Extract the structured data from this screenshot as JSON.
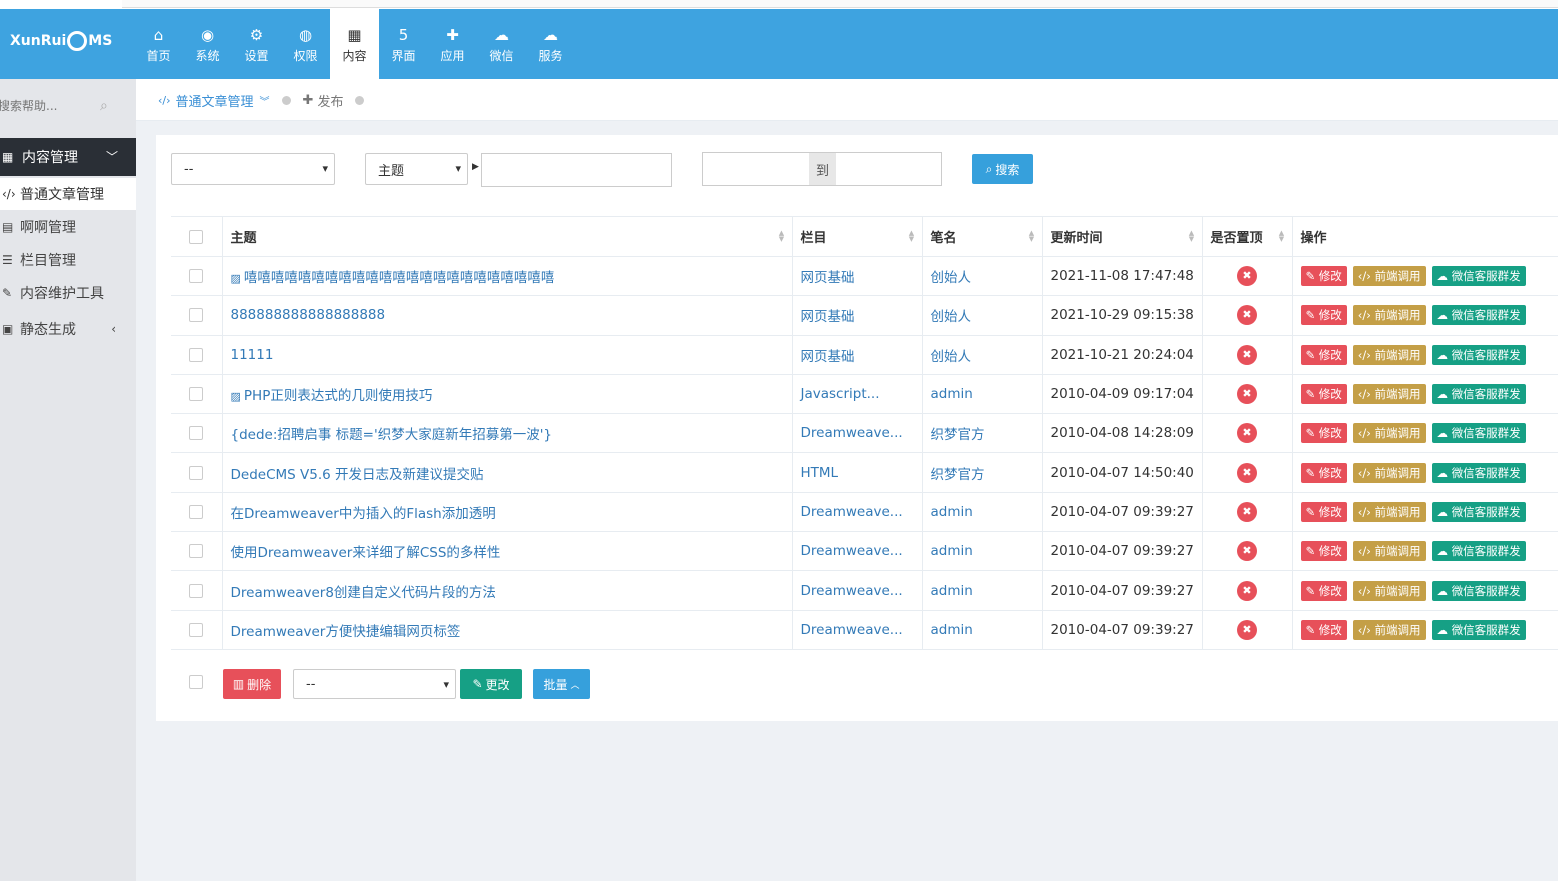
{
  "app": {
    "logo": "XunRui CMS",
    "logo_left": "XunRui",
    "logo_right": "MS"
  },
  "nav": [
    {
      "icon": "home-icon",
      "glyph": "⌂",
      "label": "首页"
    },
    {
      "icon": "globe-icon",
      "glyph": "◉",
      "label": "系统"
    },
    {
      "icon": "gear-icon",
      "glyph": "⚙",
      "label": "设置"
    },
    {
      "icon": "user-icon",
      "glyph": "◍",
      "label": "权限"
    },
    {
      "icon": "grid-icon",
      "glyph": "▦",
      "label": "内容",
      "active": true
    },
    {
      "icon": "html5-icon",
      "glyph": "5",
      "label": "界面"
    },
    {
      "icon": "puzzle-icon",
      "glyph": "✚",
      "label": "应用"
    },
    {
      "icon": "wechat-icon",
      "glyph": "☁",
      "label": "微信"
    },
    {
      "icon": "cloud-icon",
      "glyph": "☁",
      "label": "服务"
    }
  ],
  "sidebar": {
    "search_placeholder": "搜索帮助...",
    "section": "内容管理",
    "items": [
      {
        "label": "普通文章管理",
        "active": true
      },
      {
        "label": "啊啊管理"
      },
      {
        "label": "栏目管理"
      },
      {
        "label": "内容维护工具"
      },
      {
        "label": "静态生成"
      }
    ]
  },
  "breadcrumb": {
    "current": "普通文章管理",
    "publish": "发布"
  },
  "filter": {
    "category_value": "--",
    "field_value": "主题",
    "keyword_value": "",
    "to_label": "到",
    "search_label": "搜索"
  },
  "table": {
    "headers": [
      "主题",
      "栏目",
      "笔名",
      "更新时间",
      "是否置顶",
      "操作"
    ],
    "actions": {
      "edit": "修改",
      "call": "前端调用",
      "wechat": "微信客服群发"
    },
    "rows": [
      {
        "title": "嘻嘻嘻嘻嘻嘻嘻嘻嘻嘻嘻嘻嘻嘻嘻嘻嘻嘻嘻嘻嘻嘻嘻",
        "has_image": true,
        "category": "网页基础",
        "author": "创始人",
        "time": "2021-11-08 17:47:48"
      },
      {
        "title": "888888888888888888",
        "has_image": false,
        "category": "网页基础",
        "author": "创始人",
        "time": "2021-10-29 09:15:38"
      },
      {
        "title": "11111",
        "has_image": false,
        "category": "网页基础",
        "author": "创始人",
        "time": "2021-10-21 20:24:04"
      },
      {
        "title": "PHP正则表达式的几则使用技巧",
        "has_image": true,
        "category": "Javascript...",
        "author": "admin",
        "time": "2010-04-09 09:17:04"
      },
      {
        "title": "{dede:招聘启事 标题='织梦大家庭新年招募第一波'}",
        "has_image": false,
        "category": "Dreamweave...",
        "author": "织梦官方",
        "time": "2010-04-08 14:28:09"
      },
      {
        "title": "DedeCMS V5.6 开发日志及新建议提交贴",
        "has_image": false,
        "category": "HTML",
        "author": "织梦官方",
        "time": "2010-04-07 14:50:40"
      },
      {
        "title": "在Dreamweaver中为插入的Flash添加透明",
        "has_image": false,
        "category": "Dreamweave...",
        "author": "admin",
        "time": "2010-04-07 09:39:27"
      },
      {
        "title": "使用Dreamweaver来详细了解CSS的多样性",
        "has_image": false,
        "category": "Dreamweave...",
        "author": "admin",
        "time": "2010-04-07 09:39:27"
      },
      {
        "title": "Dreamweaver8创建自定义代码片段的方法",
        "has_image": false,
        "category": "Dreamweave...",
        "author": "admin",
        "time": "2010-04-07 09:39:27"
      },
      {
        "title": "Dreamweaver方便快捷编辑网页标签",
        "has_image": false,
        "category": "Dreamweave...",
        "author": "admin",
        "time": "2010-04-07 09:39:27"
      }
    ]
  },
  "footer": {
    "delete_label": "删除",
    "move_value": "--",
    "change_label": "更改",
    "batch_label": "批量"
  },
  "colors": {
    "header": "#3ea3e0",
    "danger": "#e7505a",
    "gold": "#c49f47",
    "teal": "#16a085",
    "primary": "#36a0dc"
  }
}
